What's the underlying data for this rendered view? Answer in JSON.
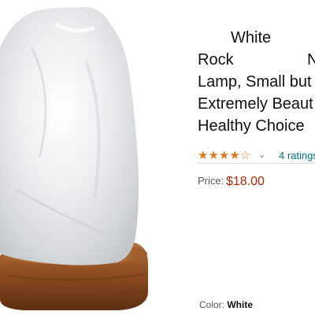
{
  "product": {
    "title_lines": [
      "White",
      "Rock",
      "N",
      "Lamp, Small but",
      "Extremely Beaut",
      "Healthy Choice"
    ],
    "rating": {
      "stars": 4,
      "ratings_text": "4 ratings",
      "chevron": "⌄"
    },
    "price": {
      "label": "Price:",
      "value": "$18.00"
    },
    "color": {
      "label": "Color:",
      "value": "White"
    }
  },
  "icons": {
    "star": "star-icon",
    "chevron": "chevron-down-icon"
  },
  "colors": {
    "star": "#de7921",
    "price": "#b12704",
    "link": "#007185",
    "text": "#0f1111"
  }
}
